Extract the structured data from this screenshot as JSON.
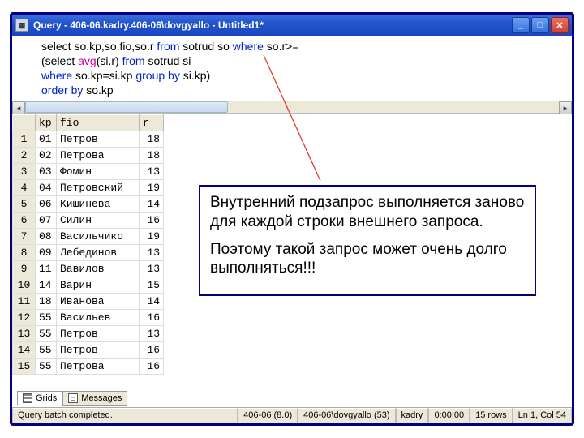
{
  "window": {
    "title": "Query - 406-06.kadry.406-06\\dovgyallo - Untitled1*"
  },
  "sql": {
    "line1_pre": "select so.kp,so.fio,so.r  ",
    "line1_kw1": "from",
    "line1_mid": " sotrud so ",
    "line1_kw2": "where",
    "line1_post": " so.r>=",
    "line2_pre": "(select ",
    "line2_agg": "avg",
    "line2_mid": "(si.r) ",
    "line2_kw1": "from",
    "line2_post": " sotrud si",
    "line3_kw1": "where",
    "line3_mid": " so.kp=si.kp ",
    "line3_kw2": "group by",
    "line3_post": " si.kp)",
    "line4_kw1": "order by",
    "line4_post": " so.kp"
  },
  "grid": {
    "headers": {
      "kp": "kp",
      "fio": "fio",
      "r": "r"
    },
    "rows": [
      {
        "n": "1",
        "kp": "01",
        "fio": "Петров",
        "r": "18"
      },
      {
        "n": "2",
        "kp": "02",
        "fio": "Петрова",
        "r": "18"
      },
      {
        "n": "3",
        "kp": "03",
        "fio": "Фомин",
        "r": "13"
      },
      {
        "n": "4",
        "kp": "04",
        "fio": "Петровский",
        "r": "19"
      },
      {
        "n": "5",
        "kp": "06",
        "fio": "Кишинева",
        "r": "14"
      },
      {
        "n": "6",
        "kp": "07",
        "fio": "Силин",
        "r": "16"
      },
      {
        "n": "7",
        "kp": "08",
        "fio": "Васильчико",
        "r": "19"
      },
      {
        "n": "8",
        "kp": "09",
        "fio": "Лебединов",
        "r": "13"
      },
      {
        "n": "9",
        "kp": "11",
        "fio": "Вавилов",
        "r": "13"
      },
      {
        "n": "10",
        "kp": "14",
        "fio": "Варин",
        "r": "15"
      },
      {
        "n": "11",
        "kp": "18",
        "fio": "Иванова",
        "r": "14"
      },
      {
        "n": "12",
        "kp": "55",
        "fio": "Васильев",
        "r": "16"
      },
      {
        "n": "13",
        "kp": "55",
        "fio": "Петров",
        "r": "13"
      },
      {
        "n": "14",
        "kp": "55",
        "fio": "Петров",
        "r": "16"
      },
      {
        "n": "15",
        "kp": "55",
        "fio": "Петрова",
        "r": "16"
      }
    ]
  },
  "callout": {
    "p1": "Внутренний подзапрос выполняется заново для каждой строки внешнего запроса.",
    "p2": "Поэтому такой запрос может очень долго выполняться!!!"
  },
  "tabs": {
    "grids": "Grids",
    "messages": "Messages"
  },
  "status": {
    "s1": "Query batch completed.",
    "s2": "406-06 (8.0)",
    "s3": "406-06\\dovgyallo (53)",
    "s4": "kadry",
    "s5": "0:00:00",
    "s6": "15 rows",
    "s7": "Ln 1, Col 54"
  }
}
